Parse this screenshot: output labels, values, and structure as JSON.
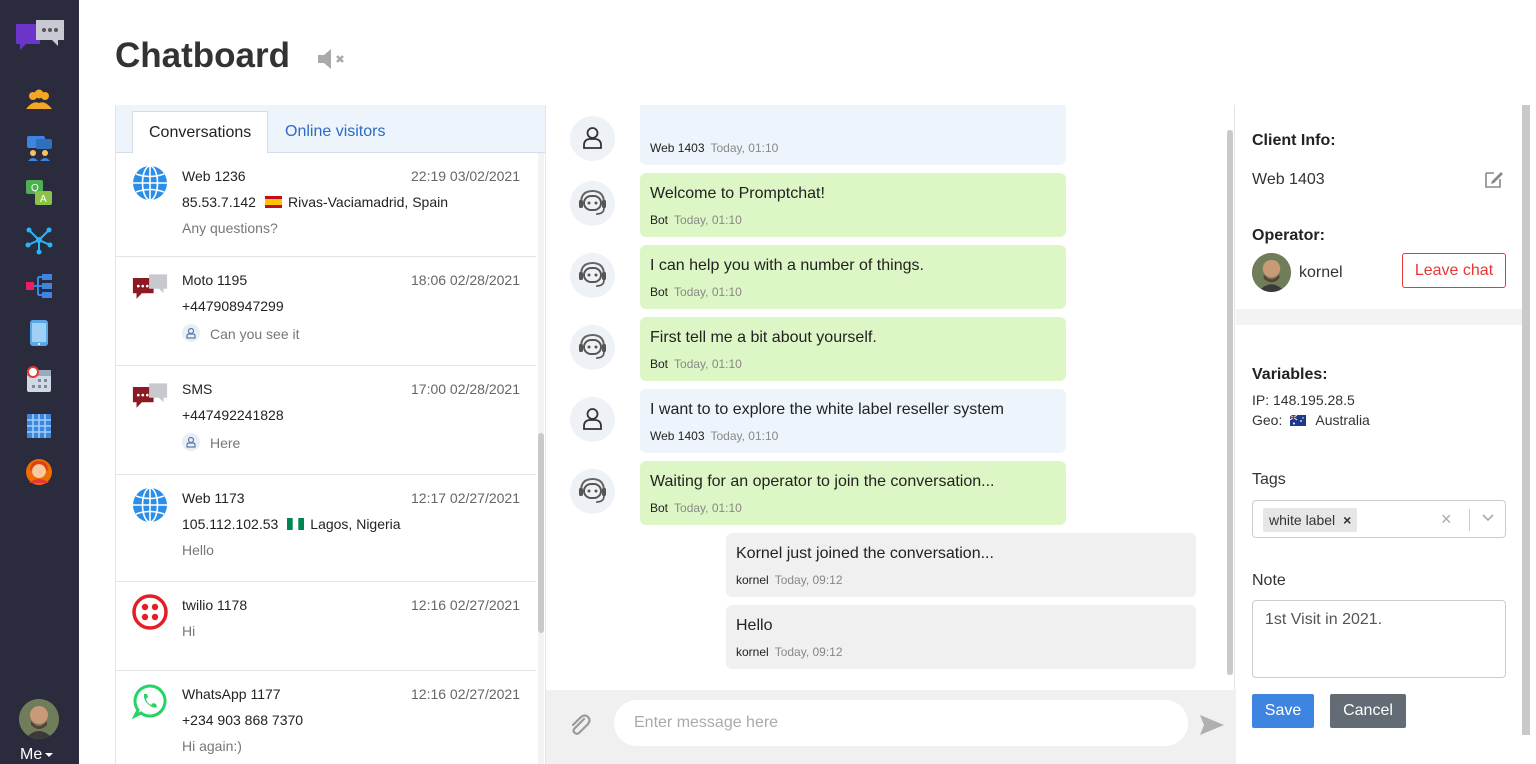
{
  "app": {
    "title": "Chatboard",
    "me_label": "Me"
  },
  "colors": {
    "sidebar_bg": "#2a2b3d",
    "accent": "#3d85e0",
    "bot_bubble": "#dcf7c5",
    "visitor_bubble": "#edf4fb",
    "operator_bubble": "#f0f0f0",
    "danger": "#e53935"
  },
  "sidebar": {
    "items": [
      {
        "icon": "users-icon"
      },
      {
        "icon": "support-team-icon"
      },
      {
        "icon": "qa-icon"
      },
      {
        "icon": "network-icon"
      },
      {
        "icon": "hierarchy-icon"
      },
      {
        "icon": "tablet-icon"
      },
      {
        "icon": "calendar-icon"
      },
      {
        "icon": "grid-icon"
      },
      {
        "icon": "agent-icon"
      }
    ]
  },
  "tabs": {
    "conversations": "Conversations",
    "online_visitors": "Online visitors"
  },
  "conversations": [
    {
      "icon": "globe-icon",
      "name": "Web 1236",
      "time": "22:19 03/02/2021",
      "line2": "85.53.7.142",
      "flag": "spain-flag-icon",
      "location": "Rivas-Vaciamadrid, Spain",
      "preview": "Any questions?",
      "operator_reply": false
    },
    {
      "icon": "chat-bubbles-icon",
      "name": "Moto 1195",
      "time": "18:06 02/28/2021",
      "line2": "+447908947299",
      "flag": "",
      "location": "",
      "preview": "Can you see it",
      "operator_reply": true
    },
    {
      "icon": "chat-bubbles-icon",
      "name": " SMS",
      "time": "17:00 02/28/2021",
      "line2": "+447492241828",
      "flag": "",
      "location": "",
      "preview": "Here",
      "operator_reply": true
    },
    {
      "icon": "globe-icon",
      "name": "Web 1173",
      "time": "12:17 02/27/2021",
      "line2": "105.112.102.53",
      "flag": "nigeria-flag-icon",
      "location": "Lagos, Nigeria",
      "preview": "Hello",
      "operator_reply": false
    },
    {
      "icon": "twilio-icon",
      "name": "twilio 1178",
      "time": "12:16 02/27/2021",
      "line2": "",
      "flag": "",
      "location": "",
      "preview": "Hi",
      "operator_reply": false
    },
    {
      "icon": "whatsapp-icon",
      "name": " WhatsApp 1177",
      "time": "12:16 02/27/2021",
      "line2": "+234 903 868 7370",
      "flag": "",
      "location": "",
      "preview": "Hi again:)",
      "operator_reply": false
    }
  ],
  "messages": [
    {
      "sender": "visitor",
      "text": "",
      "author": "Web 1403",
      "time": "Today, 01:10"
    },
    {
      "sender": "bot",
      "text": "Welcome to Promptchat!",
      "author": "Bot",
      "time": "Today, 01:10"
    },
    {
      "sender": "bot",
      "text": "I can help you with a number of things.",
      "author": "Bot",
      "time": "Today, 01:10"
    },
    {
      "sender": "bot",
      "text": "First tell me a bit about yourself.",
      "author": "Bot",
      "time": "Today, 01:10"
    },
    {
      "sender": "visitor",
      "text": "I want to to explore the white label reseller system",
      "author": "Web 1403",
      "time": "Today, 01:10"
    },
    {
      "sender": "bot",
      "text": "Waiting for an operator to join the conversation...",
      "author": "Bot",
      "time": "Today, 01:10"
    },
    {
      "sender": "operator",
      "text": "Kornel just joined the conversation...",
      "author": "kornel",
      "time": "Today, 09:12"
    },
    {
      "sender": "operator",
      "text": "Hello",
      "author": "kornel",
      "time": "Today, 09:12"
    }
  ],
  "composer": {
    "placeholder": "Enter message here"
  },
  "client_info": {
    "title": "Client Info:",
    "name": "Web 1403",
    "operator_label": "Operator:",
    "operator_name": "kornel",
    "leave_label": "Leave chat",
    "variables_label": "Variables:",
    "ip": "IP: 148.195.28.5",
    "geo_label": "Geo:",
    "geo_value": "Australia",
    "tags_label": "Tags",
    "tags": [
      "white label"
    ],
    "note_label": "Note",
    "note_value": "1st Visit in 2021.",
    "save_label": "Save",
    "cancel_label": "Cancel"
  }
}
